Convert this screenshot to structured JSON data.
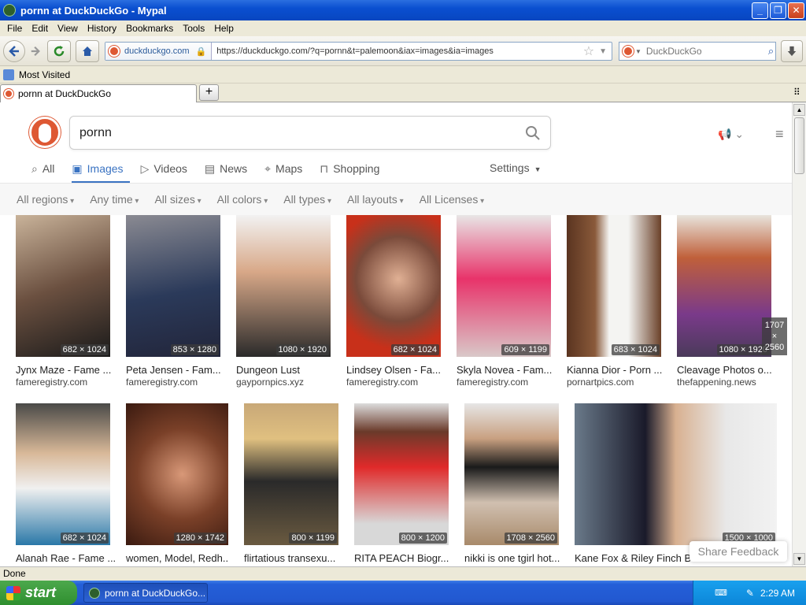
{
  "window": {
    "title": "pornn at DuckDuckGo - Mypal",
    "min": "_",
    "max": "❐",
    "close": "✕"
  },
  "menu": [
    "File",
    "Edit",
    "View",
    "History",
    "Bookmarks",
    "Tools",
    "Help"
  ],
  "nav": {
    "identity": "duckduckgo.com",
    "url": "https://duckduckgo.com/?q=pornn&t=palemoon&iax=images&ia=images",
    "search_engine": "DuckDuckGo"
  },
  "bookmarks": {
    "most_visited": "Most Visited"
  },
  "tab": {
    "title": "pornn at DuckDuckGo",
    "new_tab": "+"
  },
  "page": {
    "query": "pornn",
    "tabs": [
      {
        "label": "All",
        "icon": "search-icon"
      },
      {
        "label": "Images",
        "icon": "image-icon"
      },
      {
        "label": "Videos",
        "icon": "play-icon"
      },
      {
        "label": "News",
        "icon": "news-icon"
      },
      {
        "label": "Maps",
        "icon": "map-pin-icon"
      },
      {
        "label": "Shopping",
        "icon": "shopping-bag-icon"
      }
    ],
    "settings": "Settings",
    "filters": [
      "All regions",
      "Any time",
      "All sizes",
      "All colors",
      "All types",
      "All layouts",
      "All Licenses"
    ],
    "results": [
      {
        "title": "Jynx Maze - Fame ...",
        "source": "fameregistry.com",
        "dims": "682 × 1024"
      },
      {
        "title": "Peta Jensen - Fam...",
        "source": "fameregistry.com",
        "dims": "853 × 1280"
      },
      {
        "title": "Dungeon Lust",
        "source": "gaypornpics.xyz",
        "dims": "1080 × 1920"
      },
      {
        "title": "Lindsey Olsen - Fa...",
        "source": "fameregistry.com",
        "dims": "682 × 1024"
      },
      {
        "title": "Skyla Novea - Fam...",
        "source": "fameregistry.com",
        "dims": "609 × 1199"
      },
      {
        "title": "Kianna Dior - Porn ...",
        "source": "pornartpics.com",
        "dims": "683 × 1024"
      },
      {
        "title": "Cleavage Photos o...",
        "source": "thefappening.news",
        "dims": "1080 × 1920"
      },
      {
        "title": "Alanah Rae - Fame ...",
        "source": "",
        "dims": "682 × 1024"
      },
      {
        "title": "women, Model, Redh...",
        "source": "",
        "dims": "1280 × 1742"
      },
      {
        "title": "flirtatious transexu...",
        "source": "",
        "dims": "800 × 1199"
      },
      {
        "title": "RITA PEACH Biogr...",
        "source": "",
        "dims": "800 × 1200"
      },
      {
        "title": "nikki is one tgirl hot...",
        "source": "",
        "dims": "1708 × 2560"
      },
      {
        "title": "Kane Fox & Riley Finch Bareback Desires A...",
        "source": "",
        "dims": "1500 × 1000"
      }
    ],
    "overflow_dims": "1707 × 2560",
    "feedback": "Share Feedback"
  },
  "status": "Done",
  "taskbar": {
    "start": "start",
    "task": "pornn at DuckDuckGo...",
    "time": "2:29 AM"
  },
  "colors": {
    "accent": "#3a73c2",
    "ddg": "#de5833",
    "xp_blue": "#245fd8"
  }
}
